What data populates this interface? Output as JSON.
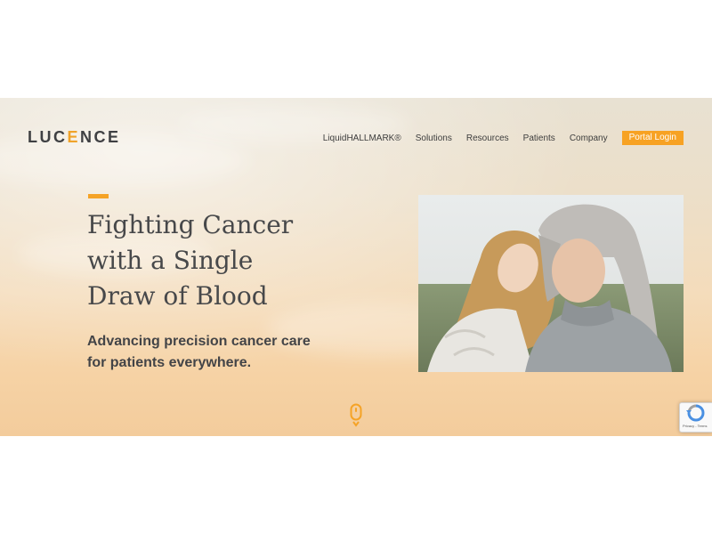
{
  "brand": {
    "logo_prefix": "LUC",
    "logo_accent": "E",
    "logo_suffix": "NCE",
    "accent_color": "#f7a223"
  },
  "nav": {
    "items": [
      {
        "label": "LiquidHALLMARK®"
      },
      {
        "label": "Solutions"
      },
      {
        "label": "Resources"
      },
      {
        "label": "Patients"
      },
      {
        "label": "Company"
      }
    ],
    "login_label": "Portal Login"
  },
  "hero": {
    "headline_lines": [
      "Fighting Cancer",
      "with a Single",
      "Draw of Blood"
    ],
    "subhead_lines": [
      "Advancing precision cancer care",
      "for patients everywhere."
    ],
    "photo_icon": "two-women-embracing-photo",
    "scroll_icon": "scroll-down-icon"
  },
  "recaptcha": {
    "icon": "recaptcha-icon",
    "footer": "Privacy - Terms"
  }
}
